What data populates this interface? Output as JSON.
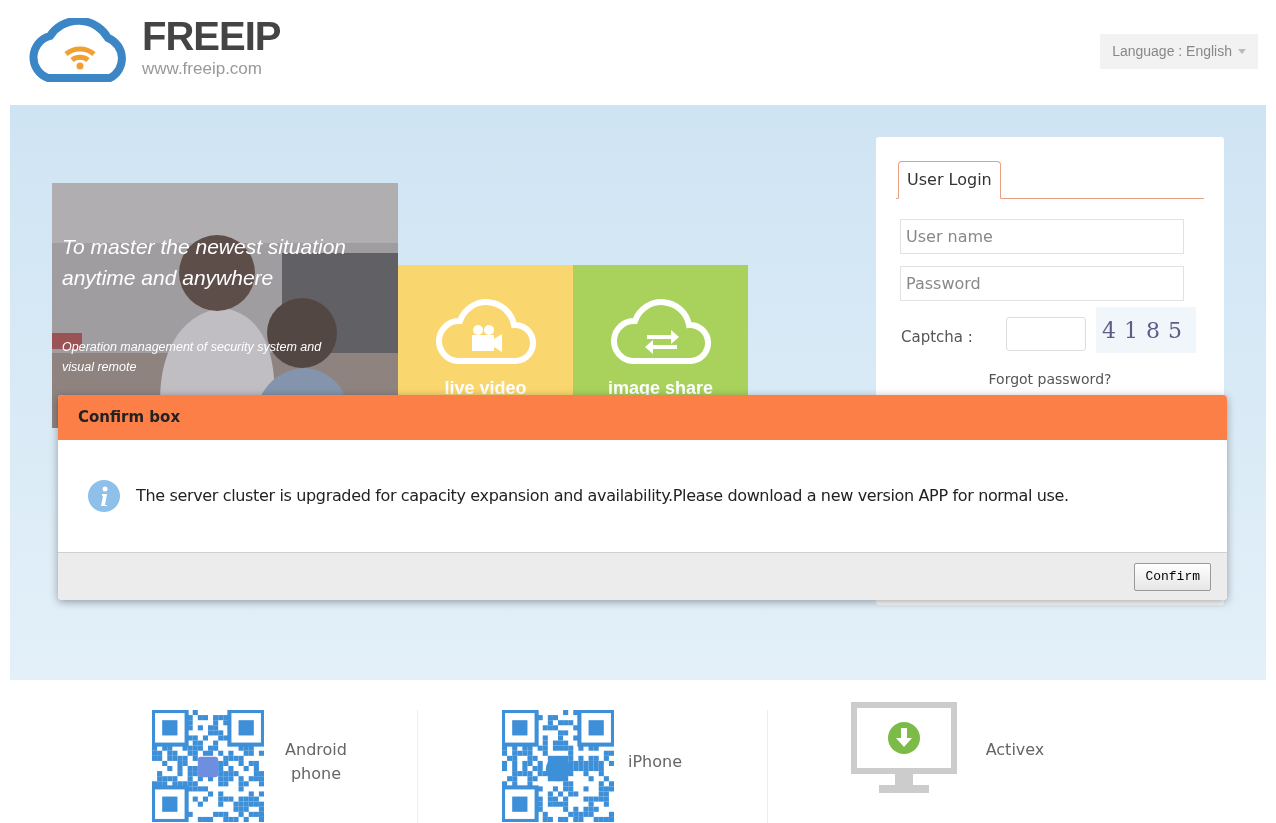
{
  "header": {
    "logo_title": "FREEIP",
    "logo_url": "www.freeip.com",
    "language_selector": "Language : English"
  },
  "banner": {
    "photo": {
      "kind": "picture",
      "headline": "To  master the newest situation anytime and anywhere",
      "subtitle": "Operation management of security system and visual remote"
    },
    "tiles": [
      {
        "label": "live video",
        "kind": "video",
        "color": "#fad66e"
      },
      {
        "label": "image share",
        "kind": "share",
        "color": "#a8d25c"
      }
    ]
  },
  "login": {
    "tabs": [
      {
        "label": "User Login",
        "selected": true
      }
    ],
    "username": {
      "placeholder": "User name"
    },
    "password": {
      "placeholder": "Password"
    },
    "captcha": {
      "label": "Captcha :",
      "code": "4185"
    },
    "forgot_link": "Forgot password?"
  },
  "dialog": {
    "title": "Confirm box",
    "message": "The server cluster is upgraded for capacity expansion and availability.Please download a new version APP for normal use.",
    "buttons": [
      "Confirm"
    ]
  },
  "downloads": [
    {
      "label": "Android phone",
      "kind": "android"
    },
    {
      "label": "iPhone",
      "kind": "apple"
    },
    {
      "label": "Activex",
      "kind": "monitor"
    }
  ]
}
